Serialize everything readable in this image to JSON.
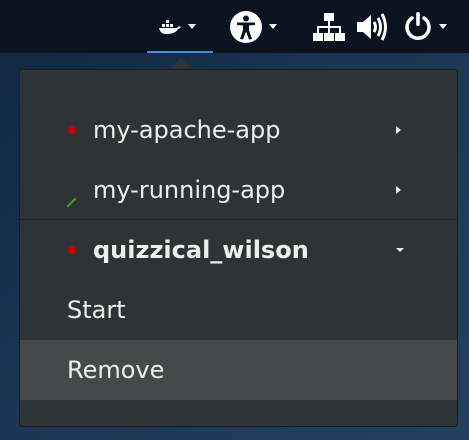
{
  "topbar": {
    "indicators": [
      {
        "name": "docker-icon",
        "has_menu": true,
        "active": true
      },
      {
        "name": "accessibility-icon",
        "has_menu": true
      },
      {
        "name": "network-icon"
      },
      {
        "name": "volume-icon"
      },
      {
        "name": "power-icon",
        "has_menu": true
      }
    ],
    "accent_color": "#4a90d9"
  },
  "menu": {
    "containers": [
      {
        "name": "my-apache-app",
        "status": "stopped",
        "status_color": "#cc0000",
        "expanded": false
      },
      {
        "name": "my-running-app",
        "status": "running",
        "status_color": "#4e9a06",
        "expanded": false
      },
      {
        "name": "quizzical_wilson",
        "status": "stopped",
        "status_color": "#cc0000",
        "expanded": true
      }
    ],
    "actions": [
      {
        "label": "Start"
      },
      {
        "label": "Remove",
        "hovered": true
      }
    ]
  }
}
